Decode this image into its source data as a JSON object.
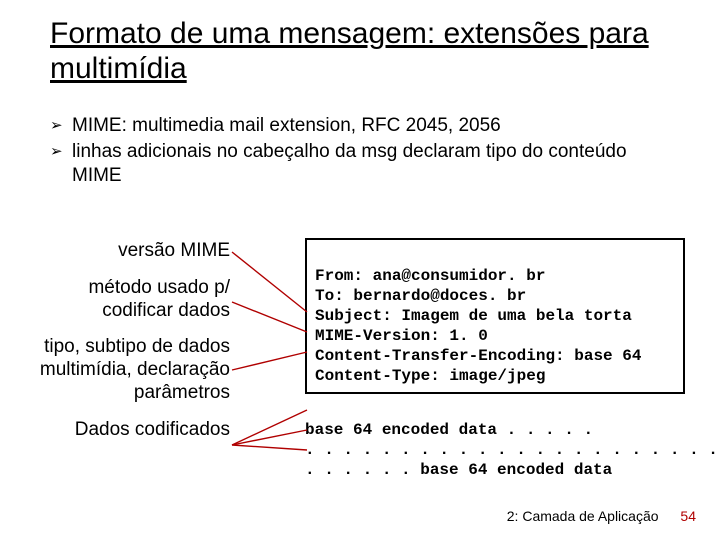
{
  "title": "Formato de uma mensagem: extensões para multimídia",
  "bullets": [
    "MIME: multimedia mail extension, RFC 2045, 2056",
    "linhas adicionais no cabeçalho da msg declaram tipo do conteúdo MIME"
  ],
  "labels": {
    "version": "versão MIME",
    "encoding": "método usado p/ codificar dados",
    "type": "tipo, subtipo de dados multimídia, declaração parâmetros",
    "data": "Dados codificados"
  },
  "code": {
    "line1": "From: ana@consumidor. br",
    "line2": "To: bernardo@doces. br",
    "line3": "Subject: Imagem de uma bela torta",
    "line4": "MIME-Version: 1. 0",
    "line5": "Content-Transfer-Encoding: base 64",
    "line6": "Content-Type: image/jpeg"
  },
  "encoded": {
    "line1": "base 64 encoded data . . . . .",
    "line2": ". . . . . . . . . . . . . . . . . . . . . . . .",
    "line3": ". . . . . . base 64 encoded data"
  },
  "footer": {
    "section": "2: Camada de Aplicação",
    "page": "54"
  }
}
